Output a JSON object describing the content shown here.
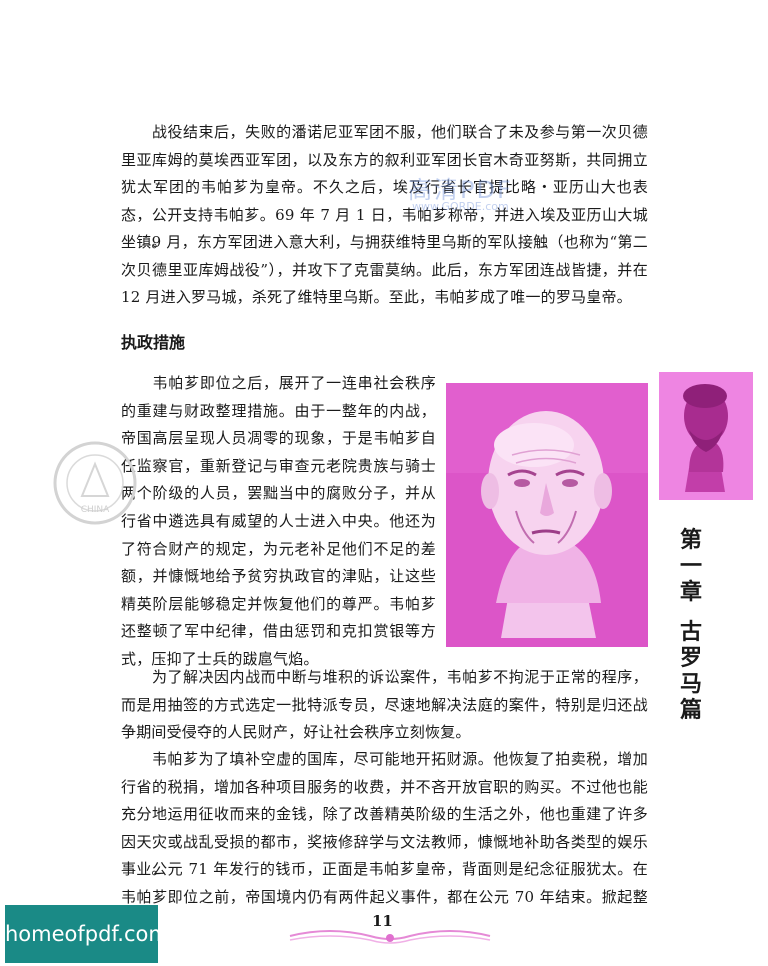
{
  "paragraphs_top": [
    "　　战役结束后，失败的潘诺尼亚军团不服，他们联合了未及参与第一次贝德里亚库姆的莫埃西亚军团，以及东方的叙利亚军团长官木奇亚努斯，共同拥立犹太军团的韦帕芗为皇帝。不久之后，埃及行省长官提比略・亚历山大也表态，公开支持韦帕芗。69 年 7 月 1 日，韦帕芗称帝，并进入埃及亚历山大城坐镇。",
    "　　9 月，东方军团进入意大利，与拥获维特里乌斯的军队接触（也称为“第二次贝德里亚库姆战役”），并攻下了克雷莫纳。此后，东方军团连战皆捷，并在 12 月进入罗马城，杀死了维特里乌斯。至此，韦帕芗成了唯一的罗马皇帝。"
  ],
  "section_heading": "执政措施",
  "paragraph_wrap": "　　韦帕芗即位之后，展开了一连串社会秩序的重建与财政整理措施。由于一整年的内战，帝国高层呈现人员凋零的现象，于是韦帕芗自任监察官，重新登记与审查元老院贵族与骑士两个阶级的人员，罢黜当中的腐败分子，并从行省中遴选具有威望的人士进入中央。他还为了符合财产的规定，为元老补足他们不足的差额，并慷慨地给予贫穷执政官的津贴，让这些精英阶层能够稳定并恢复他们的尊严。韦帕芗还整顿了军中纪律，借由惩罚和克扣赏银等方式，压抑了士兵的跋扈气焰。",
  "paragraphs_bottom": [
    "　　为了解决因内战而中断与堆积的诉讼案件，韦帕芗不拘泥于正常的程序，而是用抽签的方式选定一批特派专员，尽速地解决法庭的案件，特别是归还战争期间受侵夺的人民财产，好让社会秩序立刻恢复。",
    "　　韦帕芗为了填补空虚的国库，尽可能地开拓财源。他恢复了拍卖税，增加行省的税捐，增加各种项目服务的收费，并不吝开放官职的购买。不过他也能充分地运用征收而来的金钱，除了改善精英阶级的生活之外，他也重建了许多因天灾或战乱受损的都市，奖掖修辞学与文法教师，慷慨地补助各类型的娱乐事业。",
    "　　公元 71 年发行的钱币，正面是韦帕芗皇帝，背面则是纪念征服犹太。在韦帕芗即位之前，帝国境内仍有两件起义事件，都在公元 70 年结束。掀起整个高"
  ],
  "chapter_label": "第一章 古罗马篇",
  "chapter_chars": [
    "第",
    "一",
    "章",
    "",
    "古",
    "罗",
    "马",
    "篇"
  ],
  "watermark": {
    "text": "高清PDF",
    "sub": "www.GORDE.com"
  },
  "seal_text": "CHINA",
  "page_number": "11",
  "badge_text": "homeofpdf.com",
  "colors": {
    "photo_magenta": "#d94fc4",
    "thumb_pink": "#ee85e2",
    "badge_teal": "#1a8a86"
  }
}
